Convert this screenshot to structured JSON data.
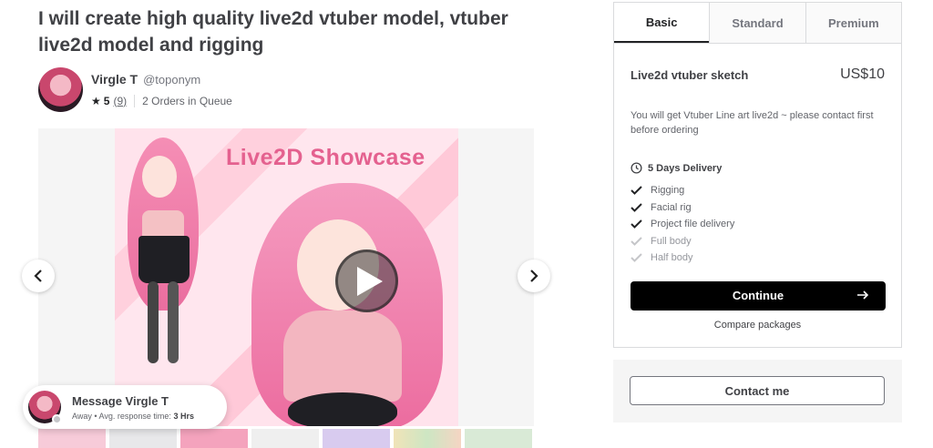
{
  "gig": {
    "title": "I will create high quality live2d vtuber model, vtuber live2d model and rigging"
  },
  "seller": {
    "name": "Virgle T",
    "handle": "@toponym",
    "rating": "5",
    "rating_count": "(9)",
    "orders_in_queue": "2 Orders in Queue"
  },
  "gallery": {
    "showcase_title": "Live2D Showcase",
    "thumbnails": 7
  },
  "message": {
    "title": "Message Virgle T",
    "status": "Away",
    "separator": "•",
    "response_label": "Avg. response time:",
    "response_time": "3 Hrs"
  },
  "package": {
    "tabs": [
      {
        "label": "Basic",
        "active": true
      },
      {
        "label": "Standard",
        "active": false
      },
      {
        "label": "Premium",
        "active": false
      }
    ],
    "name": "Live2d vtuber sketch",
    "price": "US$10",
    "description": "You will get Vtuber Line art live2d ~ please contact first before ordering",
    "delivery": "5 Days Delivery",
    "features": [
      {
        "label": "Rigging",
        "included": true
      },
      {
        "label": "Facial rig",
        "included": true
      },
      {
        "label": "Project file delivery",
        "included": true
      },
      {
        "label": "Full body",
        "included": false
      },
      {
        "label": "Half body",
        "included": false
      }
    ],
    "continue_label": "Continue",
    "compare_label": "Compare packages"
  },
  "contact": {
    "label": "Contact me"
  }
}
